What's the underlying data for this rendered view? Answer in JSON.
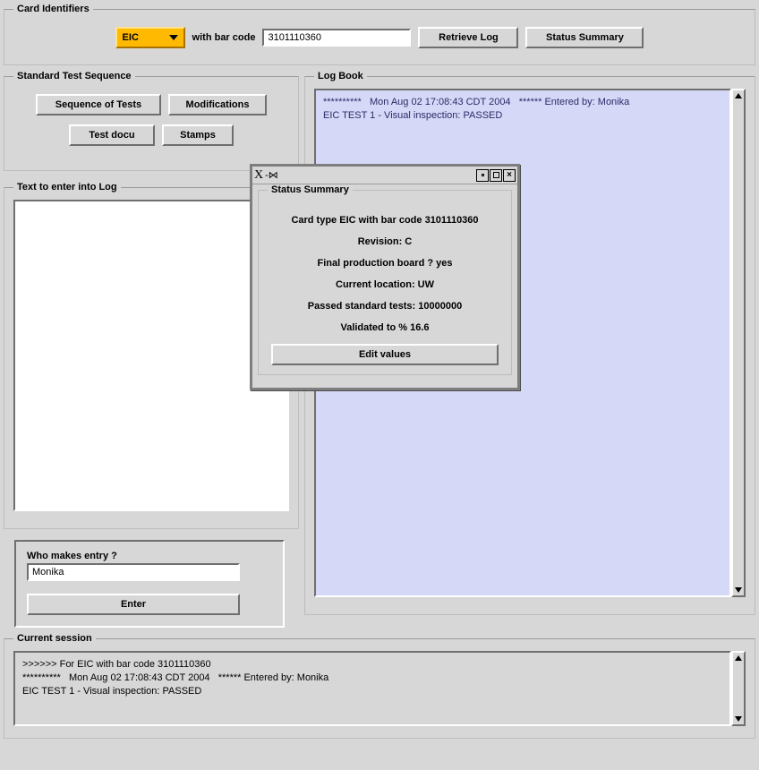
{
  "card_identifiers": {
    "legend": "Card Identifiers",
    "card_type_selected": "EIC",
    "with_bar_code_label": "with bar code",
    "bar_code_value": "3101110360",
    "retrieve_log_label": "Retrieve Log",
    "status_summary_label": "Status Summary"
  },
  "standard_test_sequence": {
    "legend": "Standard Test Sequence",
    "sequence_of_tests_label": "Sequence of Tests",
    "modifications_label": "Modifications",
    "test_docu_label": "Test docu",
    "stamps_label": "Stamps"
  },
  "text_entry": {
    "legend": "Text to enter into Log"
  },
  "who": {
    "label": "Who makes entry ?",
    "value": "Monika",
    "enter_label": "Enter"
  },
  "log_book": {
    "legend": "Log Book",
    "text": "**********   Mon Aug 02 17:08:43 CDT 2004   ****** Entered by: Monika\nEIC TEST 1 - Visual inspection: PASSED"
  },
  "current_session": {
    "legend": "Current session",
    "text": ">>>>>> For EIC with bar code 3101110360\n**********   Mon Aug 02 17:08:43 CDT 2004   ****** Entered by: Monika\nEIC TEST 1 - Visual inspection: PASSED"
  },
  "status_dialog": {
    "legend": "Status Summary",
    "line_card": "Card type EIC with bar code 3101110360",
    "line_revision": "Revision: C",
    "line_final": "Final production board ? yes",
    "line_location": "Current location: UW",
    "line_passed": "Passed standard tests: 10000000",
    "line_validated": "Validated to % 16.6",
    "edit_values_label": "Edit values"
  }
}
